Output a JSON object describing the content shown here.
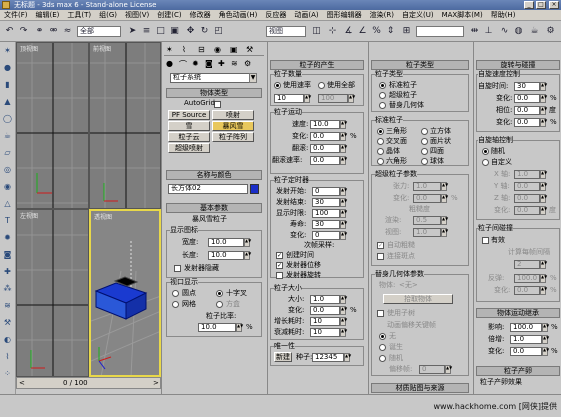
{
  "window": {
    "title": "无标题 - 3ds max 6 - Stand-alone License",
    "min": "_",
    "max": "□",
    "close": "×"
  },
  "menu": [
    "文件(F)",
    "编辑(E)",
    "工具(T)",
    "组(G)",
    "视图(V)",
    "创建(C)",
    "修改器",
    "角色动画(H)",
    "反应器",
    "动画(A)",
    "图形编辑器",
    "渲染(R)",
    "自定义(U)",
    "MAX脚本(M)",
    "帮助(H)"
  ],
  "toolbar": {
    "filter": "全部",
    "view": "视图"
  },
  "viewports": {
    "top": "顶视图",
    "front": "前视图",
    "left": "左视图",
    "persp": "透视图"
  },
  "timeslider": "0 / 100",
  "cmd": {
    "category": "粒子系统",
    "object_type_title": "物体类型",
    "autogrid": "AutoGrid",
    "buttons": [
      "PF Source",
      "喷射",
      "雪",
      "暴风雪",
      "粒子云",
      "粒子阵列",
      "超级喷射"
    ],
    "name_color_title": "名称与颜色",
    "name_value": "长方体02",
    "color": "#1a2ec8",
    "basic_title": "基本参数",
    "basic_sub": "暴风雪粒子",
    "display_icon": "显示图标",
    "width_label": "宽度:",
    "width_value": "10.0",
    "length_label": "长度:",
    "length_value": "10.0",
    "emitter_hidden": "发射器隐藏",
    "viewport_display": "视口显示",
    "dots": "圆点",
    "ticks": "十字叉",
    "mesh": "网格",
    "bbox": "方盒",
    "percent_label": "粒子比率:",
    "percent_value": "10.0",
    "percent_unit": "%"
  },
  "col1": {
    "title": "粒子的产生",
    "quantity_title": "粒子数量",
    "use_rate": "使用速率",
    "use_total": "使用全部",
    "rate_value": "10",
    "total_value": "100",
    "motion_title": "粒子运动",
    "speed_label": "速度:",
    "speed_value": "10.0",
    "variation_label": "变化:",
    "variation_value": "0.0",
    "variation_unit": "%",
    "tumble_label": "翻滚:",
    "tumble_value": "0.0",
    "tumble_rate_label": "翻滚速率:",
    "tumble_rate_value": "0.0",
    "timing_title": "粒子定时器",
    "emit_start_label": "发射开始:",
    "emit_start_value": "0",
    "emit_stop_label": "发射结束:",
    "emit_stop_value": "30",
    "display_until_label": "显示时限:",
    "display_until_value": "100",
    "life_label": "寿命:",
    "life_value": "30",
    "variation2_label": "变化:",
    "variation2_value": "0",
    "subframe_label": "次帧采样:",
    "creation_time": "创建时间",
    "emitter_translation": "发射器位移",
    "emitter_rotation": "发射器旋转",
    "size_title": "粒子大小",
    "size_label": "大小:",
    "size_value": "1.0",
    "size_var_label": "变化:",
    "size_var_value": "0.0",
    "size_var_unit": "%",
    "grow_label": "增长耗时:",
    "grow_value": "10",
    "fade_label": "衰减耗时:",
    "fade_value": "10",
    "uniq_title": "唯一性",
    "new_label": "新建",
    "seed_label": "种子:",
    "seed_value": "12345"
  },
  "col2": {
    "title": "粒子类型",
    "types_title": "粒子类型",
    "standard": "标准粒子",
    "metaparticles": "超级粒子",
    "instanced": "替身几何体",
    "std_title": "标准粒子",
    "triangle": "三角形",
    "cube": "立方体",
    "special": "交叉面",
    "facing": "面片状",
    "constant": "晶体",
    "tetra": "四面",
    "sixpoint": "六角形",
    "sphere": "球体",
    "meta_title": "超级粒子参数",
    "tension_label": "张力:",
    "tension_value": "1.0",
    "tvar_label": "变化:",
    "tvar_value": "0.0",
    "tvar_unit": "%",
    "coarse_title": "粗糙度",
    "render_label": "渲染:",
    "render_value": "0.5",
    "viewport_label": "视图:",
    "viewport_value": "1.0",
    "auto_coarse": "自动粗糙",
    "one_connected": "连接斑点",
    "inst_title": "替身几何体参数",
    "object_label": "物体:",
    "object_value": "<无>",
    "pick_object": "拾取物体",
    "use_subtree": "使用子树",
    "anim_offset": "动画偏移关键帧",
    "none": "无",
    "birth": "诞生",
    "random": "随机",
    "frame_offset_label": "偏移帧:",
    "frame_offset_value": "0",
    "mat_title": "材质贴图与来源"
  },
  "col3": {
    "rot_title": "旋转与碰撞",
    "spin_title": "自旋速度控制",
    "spin_time_label": "自旋时间:",
    "spin_time_value": "30",
    "spin_var_label": "变化:",
    "spin_var_value": "0.0",
    "spin_var_unit": "%",
    "phase_label": "相位:",
    "phase_value": "0.0",
    "phase_unit": "度",
    "phase_var_label": "变化:",
    "phase_var_value": "0.0",
    "phase_var_unit": "%",
    "axis_title": "自旋轴控制",
    "random": "随机",
    "user_defined": "自定义",
    "x_label": "X 轴:",
    "x_value": "1.0",
    "y_label": "Y 轴:",
    "y_value": "0.0",
    "z_label": "Z 轴:",
    "z_value": "0.0",
    "axis_var_label": "变化:",
    "axis_var_value": "0.0",
    "axis_var_unit": "度",
    "collide_title": "粒子间碰撞",
    "enable": "有效",
    "calc_label": "计算每帧间隔",
    "steps_label": "",
    "steps_value": "2",
    "bounce_label": "反弹:",
    "bounce_value": "100.0",
    "bounce_unit": "%",
    "bvar_label": "变化:",
    "bvar_value": "0.0",
    "bvar_unit": "%",
    "inherit_title": "物体运动继承",
    "influence_label": "影响:",
    "influence_value": "100.0",
    "influence_unit": "%",
    "mult_label": "倍增:",
    "mult_value": "1.0",
    "mvar_label": "变化:",
    "mvar_value": "0.0",
    "mvar_unit": "%",
    "spawn_title": "粒子产卵",
    "spawn_sub": "粒子产卵效果"
  },
  "watermark": "www.hackhome.com [网侠]提供"
}
